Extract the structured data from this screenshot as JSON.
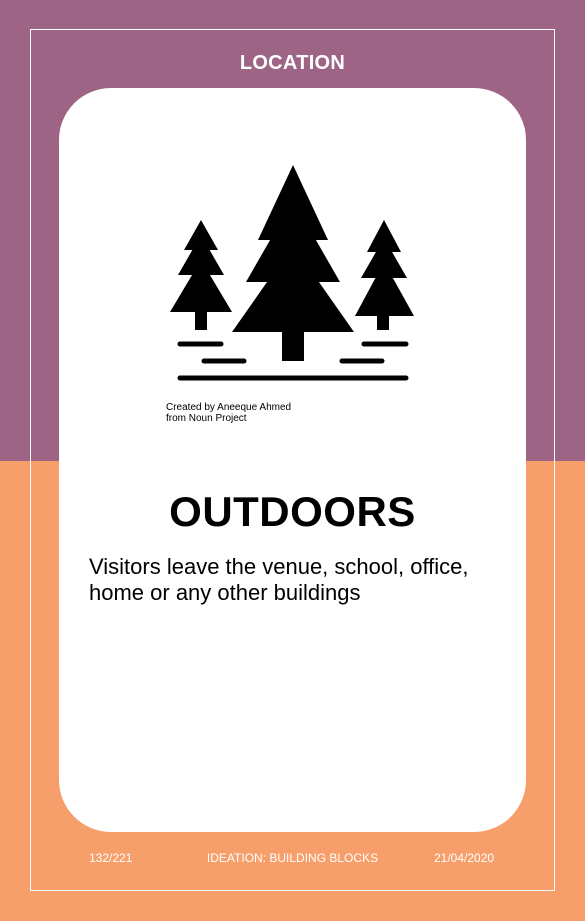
{
  "card": {
    "category": "LOCATION",
    "title": "OUTDOORS",
    "description": "Visitors leave the venue, school, office, home or any other buildings",
    "icon": "forest-trees-icon",
    "credit": {
      "line1": "Created by Aneeque Ahmed",
      "line2": "from Noun Project"
    }
  },
  "footer": {
    "page": "132/221",
    "deck": "IDEATION: BUILDING BLOCKS",
    "date": "21/04/2020"
  },
  "colors": {
    "top_band": "#9d6485",
    "bottom_band": "#f79f6b",
    "card": "#ffffff"
  }
}
